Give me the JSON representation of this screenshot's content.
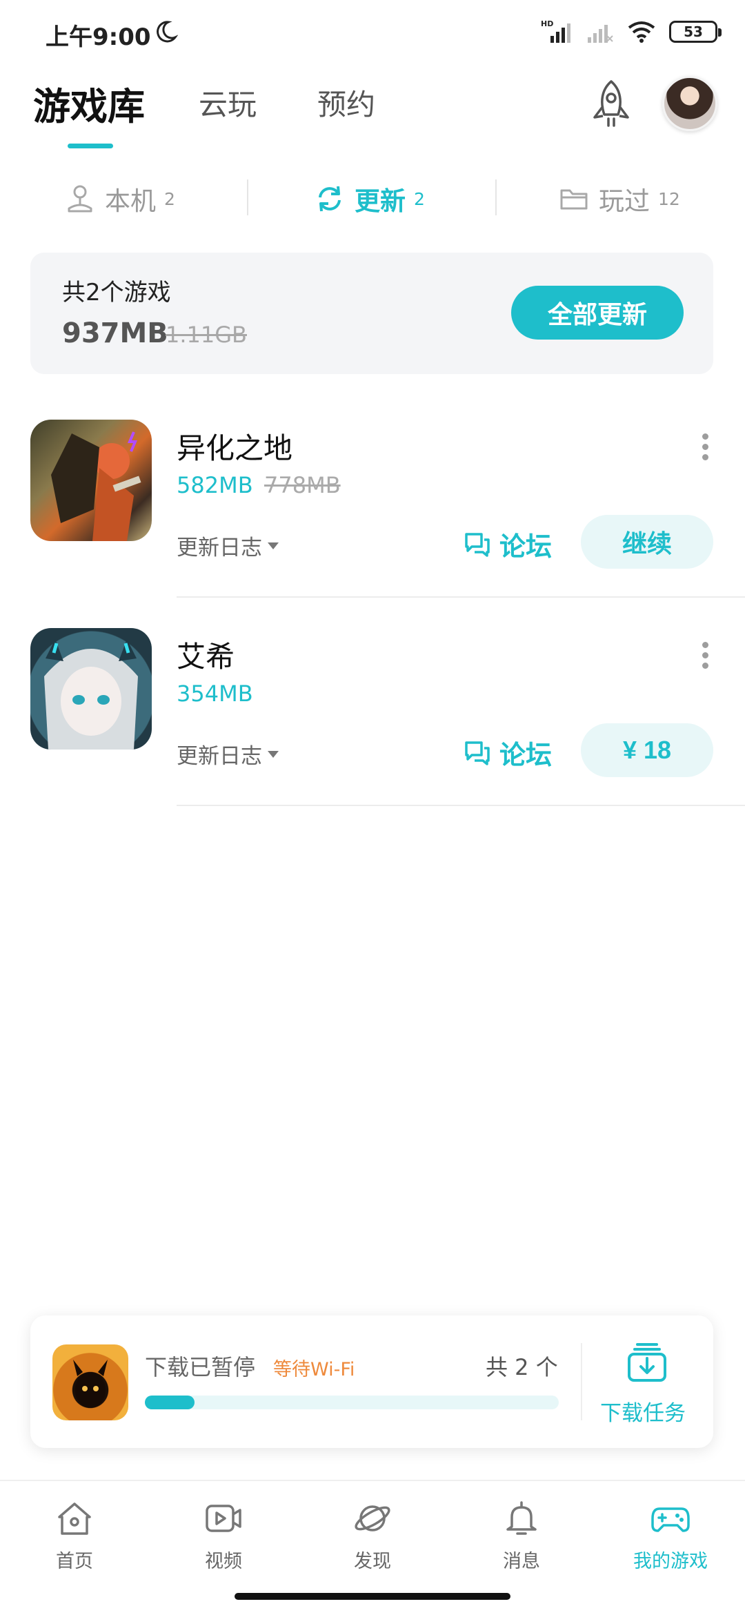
{
  "status_bar": {
    "time": "上午9:00",
    "network": "HD",
    "battery": "53"
  },
  "header": {
    "tabs": [
      {
        "label": "游戏库",
        "active": true
      },
      {
        "label": "云玩",
        "active": false
      },
      {
        "label": "预约",
        "active": false
      }
    ]
  },
  "subtabs": [
    {
      "label": "本机",
      "count": "2"
    },
    {
      "label": "更新",
      "count": "2",
      "active": true
    },
    {
      "label": "玩过",
      "count": "12"
    }
  ],
  "summary": {
    "total": "共2个游戏",
    "size": "937MB",
    "old_size": "1.11GB",
    "update_all": "全部更新"
  },
  "games": [
    {
      "title": "异化之地",
      "size": "582MB",
      "old_size": "778MB",
      "changelog": "更新日志",
      "forum": "论坛",
      "action": "继续"
    },
    {
      "title": "艾希",
      "size": "354MB",
      "old_size": "",
      "changelog": "更新日志",
      "forum": "论坛",
      "action": "¥ 18"
    }
  ],
  "download": {
    "status": "下载已暂停",
    "wait": "等待Wi-Fi",
    "count": "共 2 个",
    "progress": 0.12,
    "tasks_label": "下载任务"
  },
  "bottom_nav": [
    {
      "label": "首页",
      "icon": "home-icon"
    },
    {
      "label": "视频",
      "icon": "video-icon"
    },
    {
      "label": "发现",
      "icon": "discover-icon"
    },
    {
      "label": "消息",
      "icon": "bell-icon"
    },
    {
      "label": "我的游戏",
      "icon": "gamepad-icon",
      "active": true
    }
  ],
  "colors": {
    "accent": "#1ebecb",
    "warning": "#ee8a3c",
    "card_bg": "#f4f5f7"
  }
}
